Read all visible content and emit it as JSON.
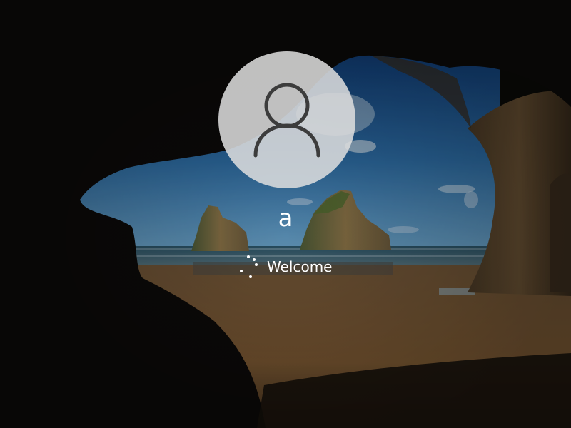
{
  "user": {
    "name": "a"
  },
  "status": {
    "text": "Welcome"
  },
  "icons": {
    "avatar": "user-silhouette-icon",
    "spinner": "loading-spinner-icon"
  },
  "colors": {
    "text": "#ffffff",
    "avatar_background": "#dedede",
    "avatar_glyph": "#3c3c3c"
  }
}
